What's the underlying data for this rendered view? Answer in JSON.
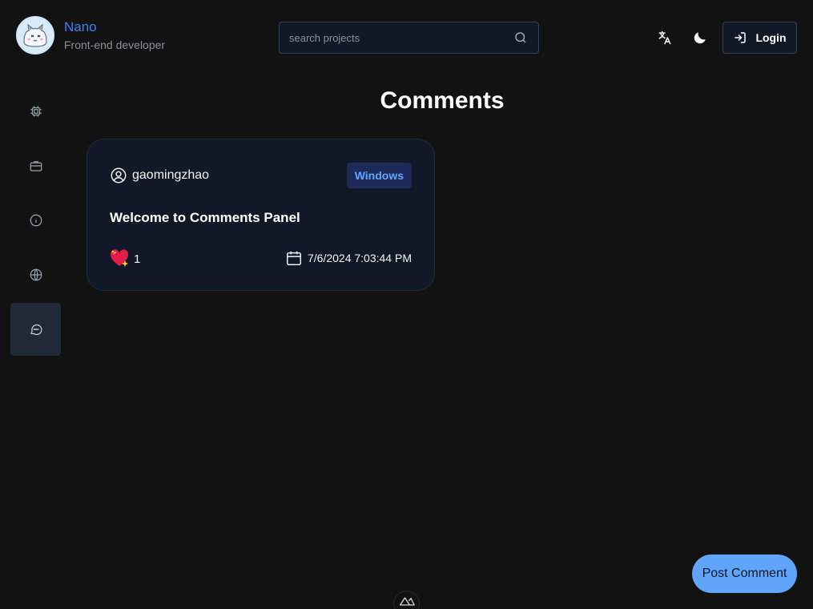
{
  "header": {
    "name": "Nano",
    "subtitle": "Front-end developer",
    "search_placeholder": "search projects",
    "login_label": "Login"
  },
  "sidebar": {
    "items": [
      {
        "icon": "cpu-icon"
      },
      {
        "icon": "briefcase-icon"
      },
      {
        "icon": "info-icon"
      },
      {
        "icon": "globe-icon"
      },
      {
        "icon": "message-icon",
        "active": true
      }
    ]
  },
  "main": {
    "title": "Comments",
    "comments": [
      {
        "user": "gaomingzhao",
        "tag": "Windows",
        "title": "Welcome to Comments Panel",
        "likes": "1",
        "date": "7/6/2024 7:03:44 PM"
      }
    ]
  },
  "actions": {
    "post_comment": "Post Comment"
  },
  "colors": {
    "background": "#121212",
    "accent": "#3b82f6",
    "card": "#111827",
    "badge_text": "#60a5fa",
    "post_button": "#60a5fa"
  }
}
